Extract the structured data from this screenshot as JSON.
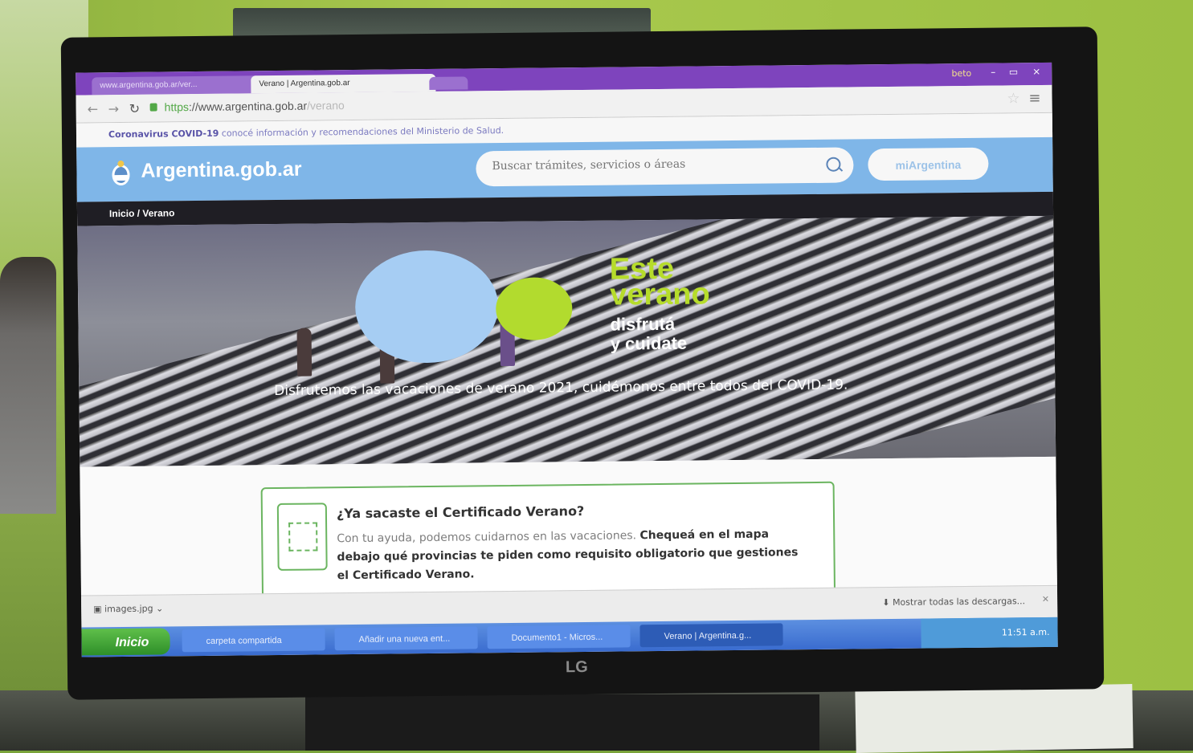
{
  "browser": {
    "tabs": [
      {
        "label": "www.argentina.gob.ar/ver..."
      },
      {
        "label": "Verano | Argentina.gob.ar"
      }
    ],
    "user": "beto",
    "window_controls": [
      "–",
      "▭",
      "×"
    ],
    "url_protocol": "https",
    "url_host": "://www.argentina.gob.ar",
    "url_path": "/verano"
  },
  "site": {
    "covid_notice_bold": "Coronavirus COVID-19",
    "covid_notice_text": " conocé información y recomendaciones del Ministerio de Salud.",
    "brand": "Argentina.gob.ar",
    "search_placeholder": "Buscar trámites, servicios o áreas",
    "mi_button": "miArgentina",
    "breadcrumb": "Inicio / Verano",
    "hero_line1": "Este",
    "hero_line2": "verano",
    "hero_line3": "disfrutá",
    "hero_line4": "y cuidate",
    "hero_caption": "Disfrutemos las vacaciones de verano 2021, cuidémonos entre todos del COVID-19.",
    "card_title": "¿Ya sacaste el Certificado Verano?",
    "card_text_a": "Con tu ayuda, podemos cuidarnos en las vacaciones.",
    "card_text_b": "Chequeá en el mapa debajo qué provincias te piden como requisito obligatorio que gestiones el Certificado Verano."
  },
  "downloads": {
    "file": "images.jpg",
    "show_all": "Mostrar todas las descargas..."
  },
  "taskbar": {
    "start": "Inicio",
    "items": [
      "carpeta compartida",
      "Añadir una nueva ent...",
      "Documento1 - Micros...",
      "Verano | Argentina.g..."
    ],
    "clock": "11:51 a.m."
  },
  "monitor_brand": "LG",
  "colors": {
    "browser_frame": "#7e44bd",
    "site_header": "#7fb6e8",
    "accent_green": "#b6dc2b",
    "card_border": "#6bb560"
  }
}
